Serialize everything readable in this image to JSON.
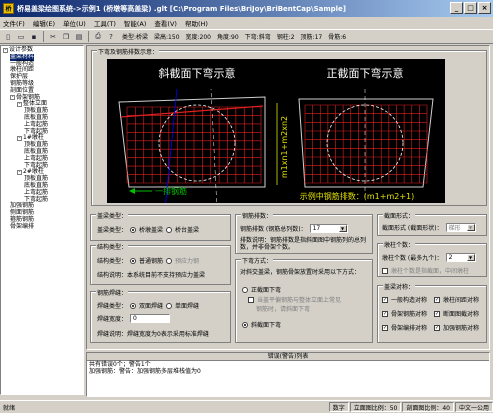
{
  "window": {
    "title": "桥易盖梁绘图系统->示例1 (桥墩等高盖梁) .glt [C:\\Program Files\\BriJoy\\BriBentCap\\Sample]",
    "icon_glyph": "桥"
  },
  "menu": [
    "文件(F)",
    "编辑(E)",
    "单位(U)",
    "工具(T)",
    "智能(A)",
    "查看(V)",
    "帮助(H)"
  ],
  "info": {
    "type": "类型:桥梁",
    "width": "梁高:150",
    "depth": "宽度:200",
    "angle": "角度:90",
    "bend": "下弯:斜弯",
    "rebar_count": "钢柱:2",
    "rebar_dia": "顶筋:17",
    "bottom": "骨筋:6"
  },
  "tree": [
    {
      "label": "设计参数",
      "indent": 0,
      "exp": "-"
    },
    {
      "label": "盖梁材料",
      "indent": 1,
      "sel": true
    },
    {
      "label": "一般构造",
      "indent": 1
    },
    {
      "label": "墩柱间距",
      "indent": 1
    },
    {
      "label": "保护层",
      "indent": 1
    },
    {
      "label": "钢筋等级",
      "indent": 1
    },
    {
      "label": "剖面位置",
      "indent": 1
    },
    {
      "label": "骨架钢筋",
      "indent": 1,
      "exp": "-"
    },
    {
      "label": "整体立面",
      "indent": 2,
      "exp": "-"
    },
    {
      "label": "顶板直筋",
      "indent": 3
    },
    {
      "label": "底板直筋",
      "indent": 3
    },
    {
      "label": "上弯起筋",
      "indent": 3
    },
    {
      "label": "下弯起筋",
      "indent": 3
    },
    {
      "label": "1#墩柱",
      "indent": 2,
      "exp": "-"
    },
    {
      "label": "顶板直筋",
      "indent": 3
    },
    {
      "label": "底板直筋",
      "indent": 3
    },
    {
      "label": "上弯起筋",
      "indent": 3
    },
    {
      "label": "下弯起筋",
      "indent": 3
    },
    {
      "label": "2#墩柱",
      "indent": 2,
      "exp": "-"
    },
    {
      "label": "顶板直筋",
      "indent": 3
    },
    {
      "label": "底板直筋",
      "indent": 3
    },
    {
      "label": "上弯起筋",
      "indent": 3
    },
    {
      "label": "下弯起筋",
      "indent": 3
    },
    {
      "label": "加强钢筋",
      "indent": 1
    },
    {
      "label": "侧面钢筋",
      "indent": 1
    },
    {
      "label": "箍筋钢筋",
      "indent": 1
    },
    {
      "label": "骨架编排",
      "indent": 1
    }
  ],
  "diagram": {
    "group_title": "下弯及钢筋排数示意：",
    "left_title": "斜截面下弯示意",
    "right_title": "正截面下弯示意",
    "formula": "m1xn1+m2xn2",
    "rebar_label": "一排钢筋",
    "example": "示例中钢筋排数：(m1+m2+1)",
    "accent": "#e02020",
    "green": "#00c000",
    "yellow": "#e0e000"
  },
  "cap_type": {
    "title": "盖梁类型：",
    "label": "盖梁类型：",
    "opt1": "桥墩盖梁",
    "opt2": "桥台盖梁"
  },
  "struct_type": {
    "title": "结构类型：",
    "label": "结构类型：",
    "opt1": "普通钢筋",
    "opt2": "预应力钢",
    "note": "结构说明：本系统目前不支持预应力盖梁"
  },
  "weld": {
    "title": "钢筋焊缝：",
    "label": "焊缝类型：",
    "opt1": "双面焊缝",
    "opt2": "单面焊缝",
    "width_label": "焊缝宽度：",
    "width_value": "0",
    "note": "焊缝说明：焊缝宽度为0表示采用标准焊缝"
  },
  "rebar_rows": {
    "title": "钢筋排数：",
    "label": "钢筋排数 (钢筋总列数)：",
    "value": "17",
    "note": "排数说明：钢筋排数是指斜面图中钢筋列的总列数，并非骨架个数。"
  },
  "bend": {
    "title": "下弯方式：",
    "desc": "对斜交盖梁，钢筋骨架放置时采用以下方式：",
    "opt1": "正截面下弯",
    "sub1": "当盖平偏钢筋与整体立面上常见",
    "sub2": "钢筋时，请斜面下弯",
    "opt2": "斜截面下弯"
  },
  "section": {
    "title": "截面形式：",
    "label": "截面形式 (截面形状)：",
    "value": "梯形"
  },
  "pier_count": {
    "title": "墩柱个数：",
    "label": "墩柱个数 (最多九个)：",
    "value": "2",
    "note": "墩柱个数是指截面，中间墩柱"
  },
  "symmetry": {
    "title": "盖梁对称：",
    "items": [
      {
        "label": "一般构造对称",
        "checked": true
      },
      {
        "label": "墩柱间距对称",
        "checked": true
      },
      {
        "label": "骨架钢筋对称",
        "checked": true
      },
      {
        "label": "断面图截对称",
        "checked": true
      },
      {
        "label": "骨架编排对称",
        "checked": true
      },
      {
        "label": "加强钢筋对称",
        "checked": true
      }
    ]
  },
  "errors": {
    "header": "错误(警告)列表",
    "lines": [
      "共有错误0个；警告1个",
      "加强钢筋：警告：加强钢筋多层堆栈值为0"
    ]
  },
  "status": {
    "ready": "就绪",
    "mode": "数字",
    "elev_scale": "立面图比例：50",
    "sect_scale": "剖面图比例：40",
    "lang": "中文一公用"
  }
}
